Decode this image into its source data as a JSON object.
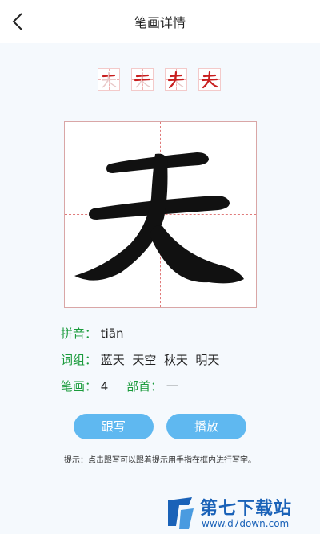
{
  "header": {
    "title": "笔画详情"
  },
  "strokes": {
    "steps": [
      {
        "char": "天",
        "complete": 1
      },
      {
        "char": "天",
        "complete": 2
      },
      {
        "char": "天",
        "complete": 3
      },
      {
        "char": "天",
        "complete": 4
      }
    ]
  },
  "character": {
    "glyph": "天"
  },
  "info": {
    "pinyin_label": "拼音：",
    "pinyin_value": "tiān",
    "words_label": "词组：",
    "words_value": "蓝天  天空  秋天  明天",
    "stroke_label": "笔画：",
    "stroke_value": "4",
    "radical_label": "部首：",
    "radical_value": "一"
  },
  "buttons": {
    "follow": "跟写",
    "play": "播放"
  },
  "hint": "提示：点击跟写可以跟着提示用手指在框内进行写字。",
  "watermark": {
    "title": "第七下载站",
    "url": "www.d7down.com"
  },
  "colors": {
    "accent_green": "#1a9b3c",
    "button_blue": "#5fb8f0",
    "stroke_red": "#c81e1e",
    "watermark_blue": "#1a62b8"
  }
}
